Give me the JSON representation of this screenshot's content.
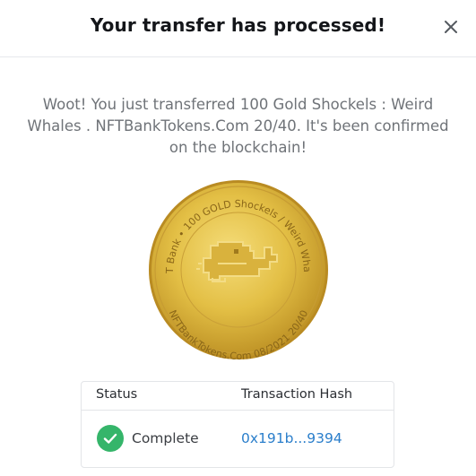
{
  "dialog": {
    "title": "Your transfer has processed!",
    "close_icon": "close-icon",
    "message": "Woot! You just transferred 100 Gold Shockels : Weird Whales . NFTBankTokens.Com 20/40. It's been confirmed on the blockchain!"
  },
  "coin": {
    "top_text": "NFT Bank • 100 GOLD Shockels / Weird Whales",
    "bottom_text": "NFTBankTokens.Com 08/2021 20/40",
    "image_icon": "whale-icon"
  },
  "status_table": {
    "headers": [
      "Status",
      "Transaction Hash"
    ],
    "status_icon": "check-icon",
    "status_value": "Complete",
    "hash_value": "0x191b...9394"
  },
  "colors": {
    "status_green": "#35b56a",
    "link_blue": "#2a7ecb",
    "coin_gold": "#e6c447"
  }
}
